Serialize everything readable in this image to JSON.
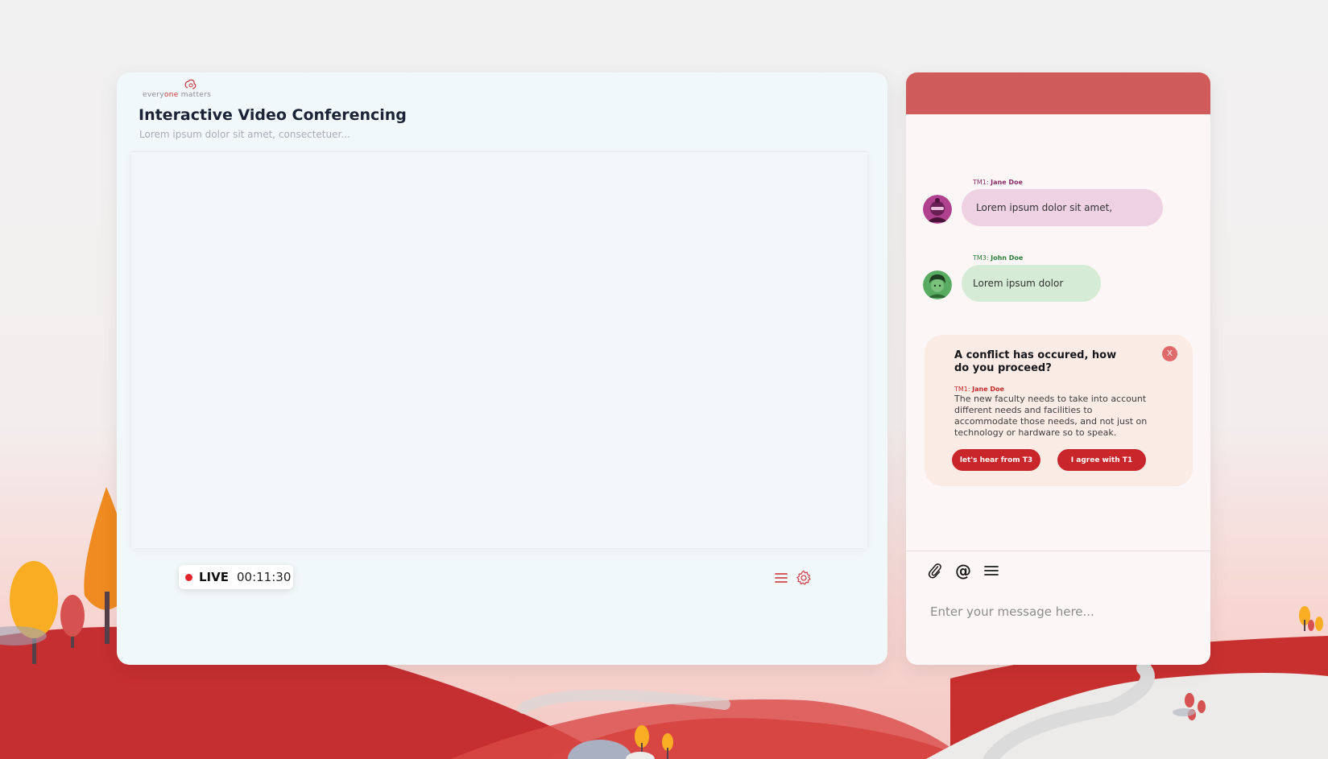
{
  "logo": {
    "text_pre": "every",
    "text_accent": "one",
    "text_post": " matters"
  },
  "conference": {
    "title": "Interactive Video Conferencing",
    "subtitle": "Lorem ipsum dolor sit amet, consectetuer..."
  },
  "status": {
    "live_label": "LIVE",
    "elapsed": "00:11:30"
  },
  "chat": {
    "messages": [
      {
        "team": "TM1: ",
        "name": "Jane Doe",
        "text": "Lorem ipsum dolor sit amet,",
        "color": "#8b2d6b"
      },
      {
        "team": "TM3: ",
        "name": "John Doe",
        "text": "Lorem ipsum dolor",
        "color": "#2e7d3c"
      }
    ],
    "conflict": {
      "title": "A conflict has occured, how do you proceed?",
      "close_label": "X",
      "author_team": "TM1: ",
      "author_name": "Jane Doe",
      "text": "The new faculty needs to take into account different needs and facilities to accommodate those needs, and not just on technology or hardware so to speak.",
      "option_1": "let's hear from T3",
      "option_2": "I agree with T1"
    },
    "composer": {
      "at_label": "@",
      "placeholder": "Enter your message here..."
    }
  },
  "colors": {
    "accent": "#c8262a",
    "header": "#cf5c5b"
  }
}
